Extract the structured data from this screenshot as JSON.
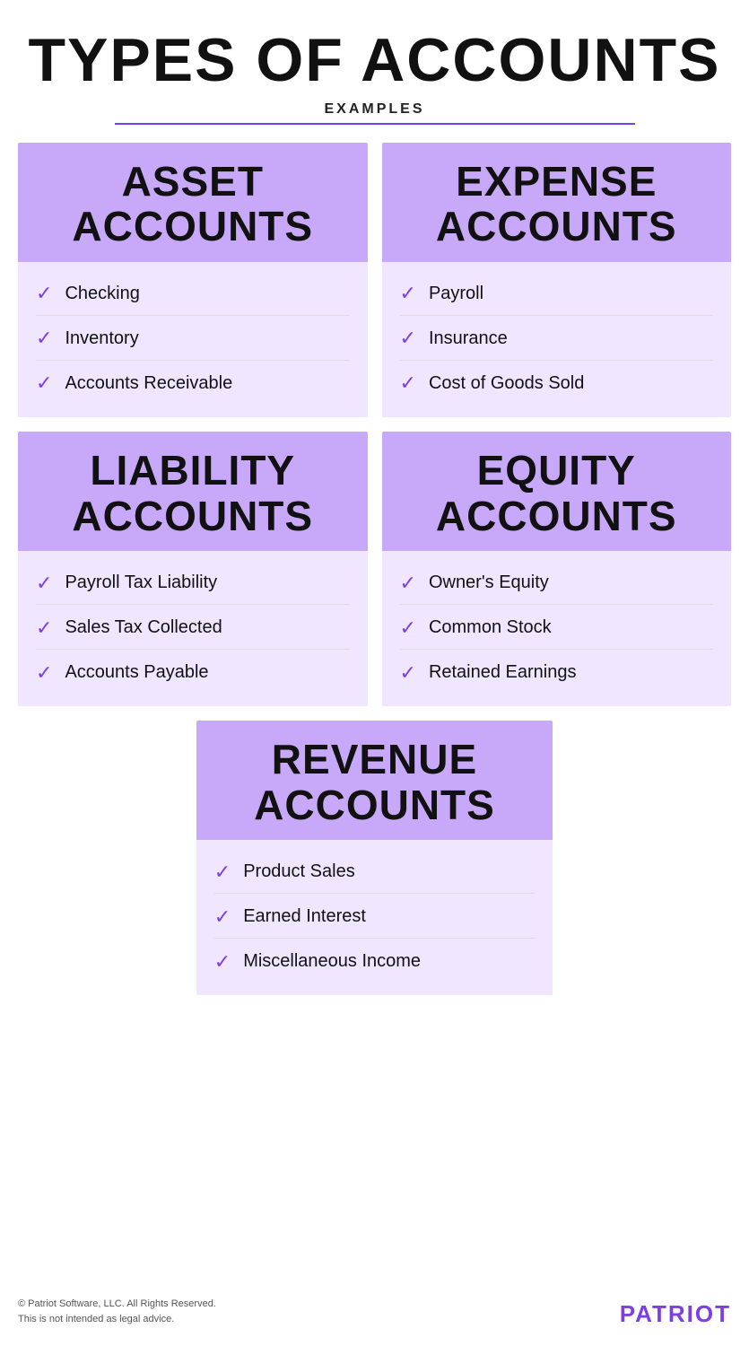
{
  "page": {
    "title": "TYPES OF ACCOUNTS",
    "subtitle": "EXAMPLES"
  },
  "accent_color": "#7b3fe4",
  "header_bg": "#c8a8f8",
  "body_bg": "#f0e6ff",
  "cards": [
    {
      "id": "asset",
      "header_line1": "ASSET",
      "header_line2": "ACCOUNTS",
      "items": [
        "Checking",
        "Inventory",
        "Accounts Receivable"
      ]
    },
    {
      "id": "expense",
      "header_line1": "EXPENSE",
      "header_line2": "ACCOUNTS",
      "items": [
        "Payroll",
        "Insurance",
        "Cost of Goods Sold"
      ]
    },
    {
      "id": "liability",
      "header_line1": "LIABILITY",
      "header_line2": "ACCOUNTS",
      "items": [
        "Payroll Tax Liability",
        "Sales Tax Collected",
        "Accounts Payable"
      ]
    },
    {
      "id": "equity",
      "header_line1": "EQUITY",
      "header_line2": "ACCOUNTS",
      "items": [
        "Owner's Equity",
        "Common Stock",
        "Retained Earnings"
      ]
    }
  ],
  "revenue_card": {
    "id": "revenue",
    "header_line1": "REVENUE",
    "header_line2": "ACCOUNTS",
    "items": [
      "Product Sales",
      "Earned Interest",
      "Miscellaneous Income"
    ]
  },
  "footer": {
    "copyright": "© Patriot Software, LLC. All Rights Reserved.",
    "disclaimer": "This is not intended as legal advice.",
    "brand": "PATRIOT"
  },
  "checkmark_char": "✓"
}
